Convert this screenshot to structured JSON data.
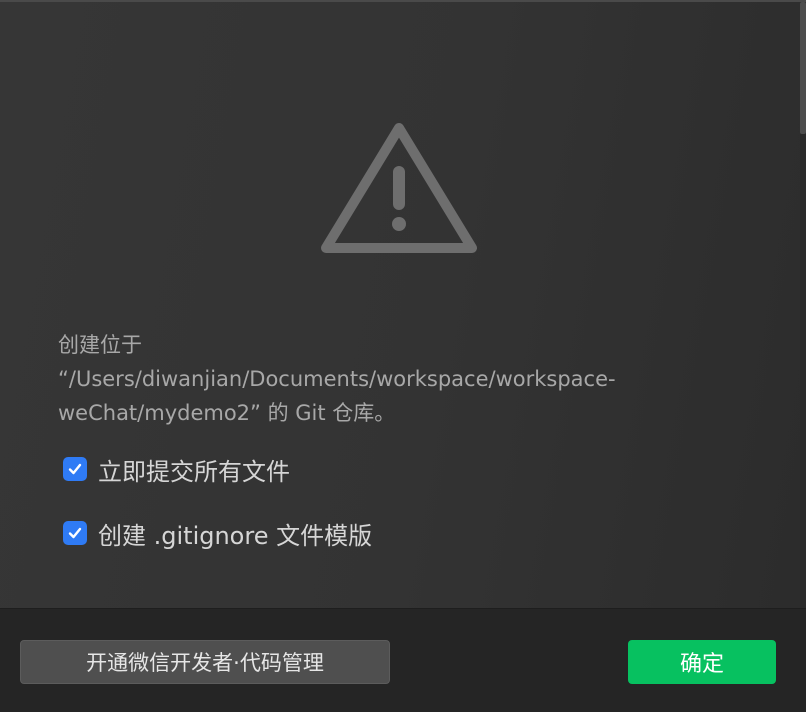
{
  "dialog": {
    "icon": "warning-triangle-icon",
    "message_lines": [
      "创建位于",
      "“/Users/diwanjian/Documents/workspace/workspace-",
      "weChat/mydemo2” 的 Git 仓库。"
    ],
    "options": [
      {
        "label": "立即提交所有文件",
        "checked": true
      },
      {
        "label": "创建 .gitignore 文件模版",
        "checked": true
      }
    ]
  },
  "footer": {
    "secondary_button_label": "开通微信开发者·代码管理",
    "primary_button_label": "确定"
  },
  "colors": {
    "accent_green": "#07c160",
    "checkbox_blue": "#2f7bf5",
    "icon_gray": "#6e6e6e"
  }
}
